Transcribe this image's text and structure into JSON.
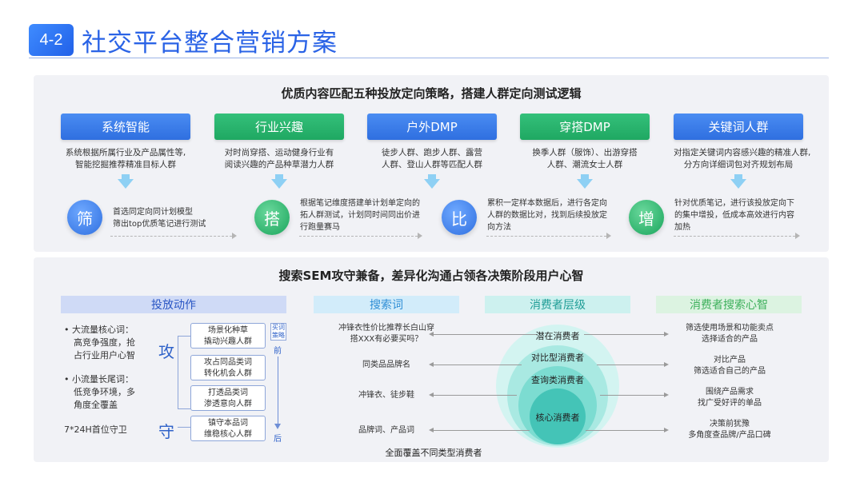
{
  "header": {
    "badge": "4-2",
    "title": "社交平台整合营销方案"
  },
  "section1": {
    "heading": "优质内容匹配五种投放定向策略，搭建人群定向测试逻辑",
    "cards": [
      {
        "label": "系统智能",
        "desc1": "系统根据所属行业及产品属性等,",
        "desc2": "智能挖掘推荐精准目标人群"
      },
      {
        "label": "行业兴趣",
        "desc1": "对时尚穿搭、运动健身行业有",
        "desc2": "阅读兴趣的产品种草潜力人群"
      },
      {
        "label": "户外DMP",
        "desc1": "徒步人群、跑步人群、露营",
        "desc2": "人群、登山人群等匹配人群"
      },
      {
        "label": "穿搭DMP",
        "desc1": "换季人群（服饰）、出游穿搭",
        "desc2": "人群、潮流女士人群"
      },
      {
        "label": "关键词人群",
        "desc1": "对指定关键词内容感兴趣的精准人群,",
        "desc2": "分方向详细词包对齐规划布局"
      }
    ],
    "steps": [
      {
        "char": "筛",
        "line1": "首选同定向同计划模型",
        "line2": "筛出top优质笔记进行测试",
        "line3": ""
      },
      {
        "char": "搭",
        "line1": "根据笔记维度搭建单计划单定向的",
        "line2": "拓人群测试，计划同时间同出价进",
        "line3": "行跑量赛马"
      },
      {
        "char": "比",
        "line1": "累积一定样本数据后，进行各定向",
        "line2": "人群的数据比对，找到后续投放定",
        "line3": "向方法"
      },
      {
        "char": "增",
        "line1": "针对优质笔记，进行该投放定向下",
        "line2": "的集中增投，低成本高效进行内容",
        "line3": "加热"
      }
    ]
  },
  "section2": {
    "heading": "搜索SEM攻守兼备，差异化沟通占领各决策阶段用户心智",
    "pills": {
      "action": "投放动作",
      "keywords": "搜索词",
      "layers": "消费者层级",
      "mindset": "消费者搜索心智"
    },
    "bullets": [
      {
        "line1": "•  大流量核心词：",
        "line2": "高竞争强度，抢",
        "line3": "占行业用户心智"
      },
      {
        "line1": "•  小流量长尾词：",
        "line2": "低竞争环境，多",
        "line3": "角度全覆盖"
      }
    ],
    "guard_note": "7*24H首位守卫",
    "attack": "攻",
    "defend": "守",
    "actions": [
      {
        "l1": "场景化种草",
        "l2": "撬动兴趣人群"
      },
      {
        "l1": "攻占同品类词",
        "l2": "转化机会人群"
      },
      {
        "l1": "打透品类词",
        "l2": "渗透意向人群"
      },
      {
        "l1": "镇守本品词",
        "l2": "维稳核心人群"
      }
    ],
    "timeline": {
      "tag1": "买词",
      "tag2": "策略",
      "before": "前",
      "after": "后"
    },
    "keywords": [
      {
        "l1": "冲锋衣性价比推荐长白山穿",
        "l2": "搭XXX有必要买吗？"
      },
      {
        "l1": "同类品品牌名",
        "l2": ""
      },
      {
        "l1": "冲锋衣、徒步鞋",
        "l2": ""
      },
      {
        "l1": "品牌词、产品词",
        "l2": ""
      }
    ],
    "layers": [
      "潜在消费者",
      "对比型消费者",
      "查询类消费者",
      "核心消费者"
    ],
    "mindsets": [
      {
        "l1": "筛选使用场景和功能卖点",
        "l2": "选择适合的产品"
      },
      {
        "l1": "对比产品",
        "l2": "筛选适合自己的产品"
      },
      {
        "l1": "围绕产品需求",
        "l2": "找广受好评的单品"
      },
      {
        "l1": "决策前犹豫",
        "l2": "多角度查品牌/产品口碑"
      }
    ],
    "footer": "全面覆盖不同类型消费者"
  }
}
